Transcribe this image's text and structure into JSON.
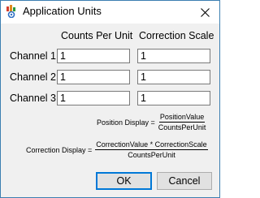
{
  "window": {
    "title": "Application Units"
  },
  "columns": {
    "counts_per_unit": "Counts Per Unit",
    "correction_scale": "Correction Scale"
  },
  "rows": [
    {
      "label": "Channel 1",
      "counts_per_unit": "1",
      "correction_scale": "1"
    },
    {
      "label": "Channel 2",
      "counts_per_unit": "1",
      "correction_scale": "1"
    },
    {
      "label": "Channel 3",
      "counts_per_unit": "1",
      "correction_scale": "1"
    }
  ],
  "formulas": {
    "position_display": {
      "lhs": "Position Display =",
      "numerator": "PositionValue",
      "denominator": "CountsPerUnit"
    },
    "correction_display": {
      "lhs": "Correction Display =",
      "numerator": "CorrectionValue * CorrectionScale",
      "denominator": "CountsPerUnit"
    }
  },
  "buttons": {
    "ok": "OK",
    "cancel": "Cancel"
  },
  "icons": {
    "app": "application-units-icon",
    "close": "close-icon"
  }
}
